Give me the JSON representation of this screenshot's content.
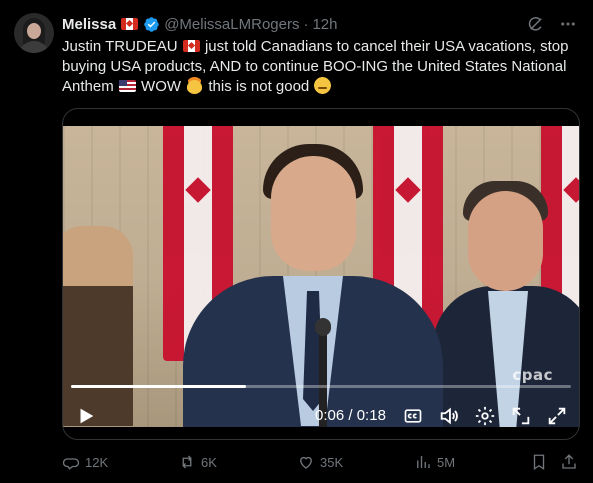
{
  "tweet": {
    "author_name": "Melissa",
    "handle": "@MelissaLMRogers",
    "separator": "·",
    "timestamp": "12h",
    "text_part1": "Justin TRUDEAU",
    "text_part2": "just told Canadians to cancel their USA vacations, stop buying USA products, AND to continue BOO-ING the United States National Anthem",
    "text_part3": "WOW",
    "text_part4": "this is not good",
    "emojis": [
      "canada-flag",
      "us-flag",
      "exploding-head",
      "unamused-face"
    ]
  },
  "video": {
    "current_time": "0:06",
    "duration": "0:18",
    "time_separator": " / ",
    "progress": 0.35,
    "watermark": "cpac"
  },
  "actions": {
    "replies": "12K",
    "reposts": "6K",
    "likes": "35K",
    "views": "5M"
  },
  "colors": {
    "background": "#000000",
    "text": "#e7e9ea",
    "muted": "#71767b",
    "verified": "#1d9bf0"
  }
}
